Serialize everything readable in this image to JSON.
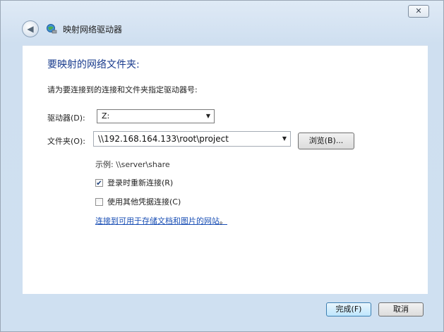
{
  "window": {
    "title": "映射网络驱动器",
    "close_label": "✕"
  },
  "content": {
    "heading": "要映射的网络文件夹:",
    "instruction": "请为要连接到的连接和文件夹指定驱动器号:",
    "drive_label": "驱动器(D):",
    "drive_value": "Z:",
    "folder_label": "文件夹(O):",
    "folder_value": "\\\\192.168.164.133\\root\\project",
    "browse_label": "浏览(B)...",
    "example_text": "示例: \\\\server\\share",
    "reconnect_label": "登录时重新连接(R)",
    "reconnect_checked": true,
    "other_credentials_label": "使用其他凭据连接(C)",
    "other_credentials_checked": false,
    "link_text": "连接到可用于存储文档和图片的网站",
    "link_suffix": "。"
  },
  "footer": {
    "finish_label": "完成(F)",
    "cancel_label": "取消"
  },
  "colors": {
    "heading": "#1a3c8e",
    "link": "#1a4fb5",
    "chrome": "#cfdff0"
  }
}
